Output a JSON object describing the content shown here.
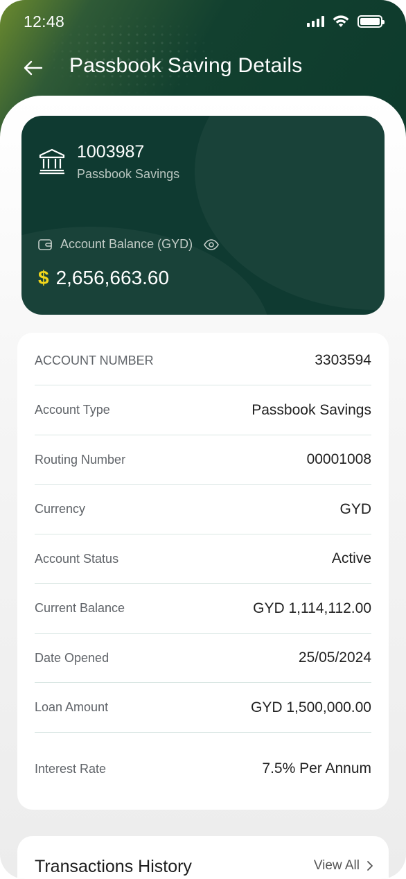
{
  "status_bar": {
    "time": "12:48"
  },
  "header": {
    "title": "Passbook Saving Details"
  },
  "account_card": {
    "account_number": "1003987",
    "account_type": "Passbook Savings",
    "balance_label": "Account Balance (GYD)",
    "currency_symbol": "$",
    "balance": "2,656,663.60"
  },
  "details": [
    {
      "label": "ACCOUNT NUMBER",
      "value": "3303594"
    },
    {
      "label": "Account Type",
      "value": "Passbook Savings"
    },
    {
      "label": "Routing Number",
      "value": "00001008"
    },
    {
      "label": "Currency",
      "value": "GYD"
    },
    {
      "label": "Account Status",
      "value": "Active"
    },
    {
      "label": "Current Balance",
      "value": "GYD 1,114,112.00"
    },
    {
      "label": "Date Opened",
      "value": "25/05/2024"
    },
    {
      "label": "Loan Amount",
      "value": "GYD 1,500,000.00"
    },
    {
      "label": "Interest Rate",
      "value": "7.5% Per Annum"
    }
  ],
  "transactions": {
    "title": "Transactions History",
    "view_all": "View All"
  },
  "colors": {
    "header_dark": "#0d3a2c",
    "card_bg": "#0f3a31",
    "currency_accent": "#f2d61b",
    "divider": "#d9e6e3"
  }
}
